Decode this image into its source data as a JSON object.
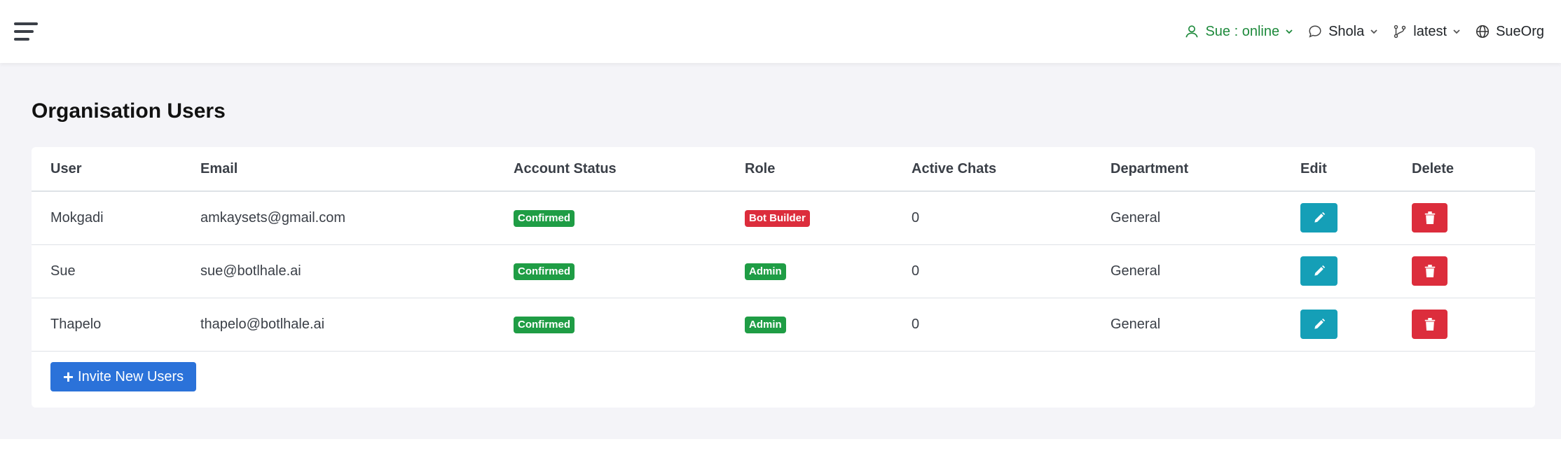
{
  "header": {
    "user_status": "Sue : online",
    "chat_user": "Shola",
    "version": "latest",
    "org": "SueOrg"
  },
  "page": {
    "title_bold": "Organisation",
    "title_rest": " Users"
  },
  "table": {
    "columns": [
      "User",
      "Email",
      "Account Status",
      "Role",
      "Active Chats",
      "Department",
      "Edit",
      "Delete"
    ],
    "rows": [
      {
        "user": "Mokgadi",
        "email": "amkaysets@gmail.com",
        "status": "Confirmed",
        "role": "Bot Builder",
        "role_color": "#dc2d3c",
        "chats": "0",
        "department": "General"
      },
      {
        "user": "Sue",
        "email": "sue@botlhale.ai",
        "status": "Confirmed",
        "role": "Admin",
        "role_color": "#1f9d45",
        "chats": "0",
        "department": "General"
      },
      {
        "user": "Thapelo",
        "email": "thapelo@botlhale.ai",
        "status": "Confirmed",
        "role": "Admin",
        "role_color": "#1f9d45",
        "chats": "0",
        "department": "General"
      }
    ]
  },
  "actions": {
    "invite_label": "Invite New Users"
  },
  "colors": {
    "online": "#1e8a3c",
    "edit": "#159fb7",
    "delete": "#dc2d3c",
    "primary": "#2b72d9",
    "confirmed": "#1f9d45"
  }
}
